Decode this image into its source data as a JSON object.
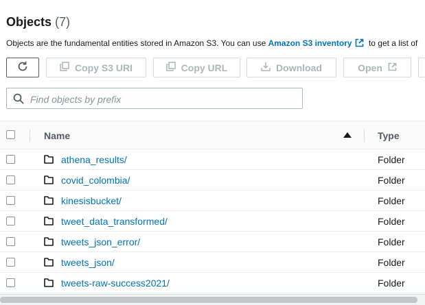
{
  "header": {
    "title": "Objects",
    "count": "(7)"
  },
  "description": {
    "prefix": "Objects are the fundamental entities stored in Amazon S3. You can use ",
    "link": "Amazon S3 inventory",
    "suffix": " to get a list of"
  },
  "toolbar": {
    "copy_s3_uri": "Copy S3 URI",
    "copy_url": "Copy URL",
    "download": "Download",
    "open": "Open"
  },
  "search": {
    "placeholder": "Find objects by prefix"
  },
  "table": {
    "columns": {
      "name": "Name",
      "type": "Type"
    },
    "sort": "ascending",
    "rows": [
      {
        "name": "athena_results/",
        "type": "Folder"
      },
      {
        "name": "covid_colombia/",
        "type": "Folder"
      },
      {
        "name": "kinesisbucket/",
        "type": "Folder"
      },
      {
        "name": "tweet_data_transformed/",
        "type": "Folder"
      },
      {
        "name": "tweets_json_error/",
        "type": "Folder"
      },
      {
        "name": "tweets_json/",
        "type": "Folder"
      },
      {
        "name": "tweets-raw-success2021/",
        "type": "Folder"
      }
    ]
  },
  "colors": {
    "link": "#0073bb",
    "text": "#16191f",
    "muted": "#545b64",
    "disabled": "#aab7b8"
  }
}
